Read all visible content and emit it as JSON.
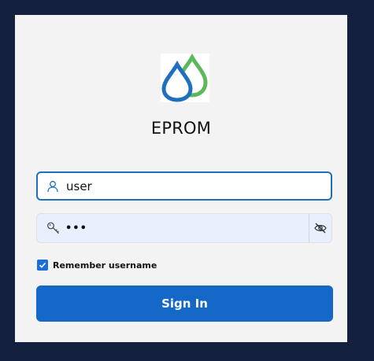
{
  "app": {
    "title": "EPROM",
    "logo_icon": "water-drops-logo"
  },
  "login": {
    "username_value": "user",
    "username_icon": "person-icon",
    "password_value": "•••",
    "password_icon": "key-icon",
    "reveal_icon": "eye-off-icon",
    "remember_label": "Remember username",
    "remember_checked": true,
    "signin_label": "Sign In"
  },
  "colors": {
    "outer_background": "#13213f",
    "panel_background": "#f3f3f3",
    "accent": "#1468c8",
    "focus_border": "#1f6fbf",
    "autofill_background": "#e8f0fe",
    "logo_blue": "#1e6fc0",
    "logo_green": "#5cb85c"
  }
}
